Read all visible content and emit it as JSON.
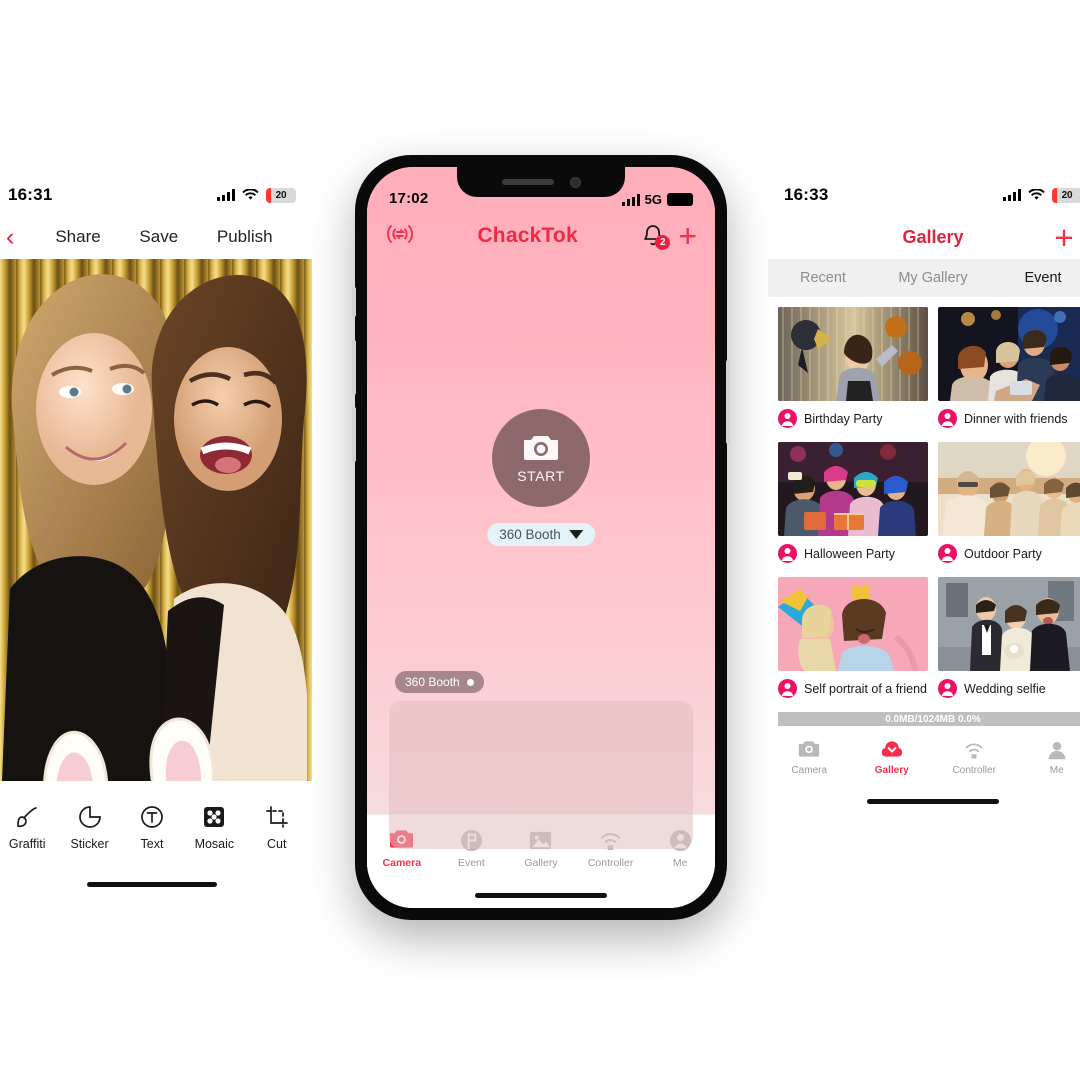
{
  "left_phone": {
    "status": {
      "time": "16:31",
      "battery": "20",
      "signal_icon": "cellular-bars-icon",
      "wifi_icon": "wifi-icon"
    },
    "nav": {
      "back_icon": "chevron-left-icon",
      "actions": [
        "Share",
        "Save",
        "Publish"
      ]
    },
    "photo": {
      "description": "Two women at a photo booth with gold foil curtain backdrop",
      "sticker": "bunny-ears-sticker"
    },
    "toolbar": [
      {
        "icon": "brush-icon",
        "label": "Graffiti"
      },
      {
        "icon": "sticker-icon",
        "label": "Sticker"
      },
      {
        "icon": "text-icon",
        "label": "Text"
      },
      {
        "icon": "mosaic-icon",
        "label": "Mosaic"
      },
      {
        "icon": "crop-icon",
        "label": "Cut"
      }
    ]
  },
  "center_phone": {
    "status": {
      "time": "17:02",
      "network": "5G",
      "signal_icon": "cellular-bars-icon",
      "battery_icon": "battery-full-icon"
    },
    "header": {
      "sync_icon": "broadcast-sync-icon",
      "title": "ChackTok",
      "bell_icon": "bell-icon",
      "bell_badge": "2",
      "add_icon": "plus-icon"
    },
    "capture": {
      "camera_icon": "camera-icon",
      "start_label": "START",
      "mode_label": "360 Booth",
      "mode_caret_icon": "caret-down-icon"
    },
    "queue": {
      "pill_label": "360 Booth",
      "pill_dot_icon": "status-dot-icon"
    },
    "tabs": [
      {
        "icon": "camera-icon",
        "label": "Camera",
        "active": true
      },
      {
        "icon": "event-flag-icon",
        "label": "Event",
        "active": false
      },
      {
        "icon": "gallery-image-icon",
        "label": "Gallery",
        "active": false
      },
      {
        "icon": "controller-wifi-icon",
        "label": "Controller",
        "active": false
      },
      {
        "icon": "person-icon",
        "label": "Me",
        "active": false
      }
    ],
    "colors": {
      "brand": "#ee2b42",
      "accent": "#f5304c",
      "bg_top": "#ffadba",
      "bg_bottom": "#f2dcdc"
    }
  },
  "right_phone": {
    "status": {
      "time": "16:33",
      "battery": "20",
      "signal_icon": "cellular-bars-icon",
      "wifi_icon": "wifi-icon"
    },
    "nav": {
      "title": "Gallery",
      "add_icon": "plus-icon"
    },
    "segments": [
      {
        "label": "Recent",
        "active": false
      },
      {
        "label": "My Gallery",
        "active": false
      },
      {
        "label": "Event",
        "active": true
      }
    ],
    "gallery": [
      [
        {
          "label": "Birthday Party",
          "avatar_icon": "person-avatar-icon",
          "thumb": "woman-with-balloons-gold-curtain"
        },
        {
          "label": "Dinner with friends",
          "avatar_icon": "person-avatar-icon",
          "thumb": "friends-selfie-at-bar"
        }
      ],
      [
        {
          "label": "Halloween Party",
          "avatar_icon": "person-avatar-icon",
          "thumb": "costume-party-group"
        },
        {
          "label": "Outdoor Party",
          "avatar_icon": "person-avatar-icon",
          "thumb": "outdoor-sunset-group"
        }
      ],
      [
        {
          "label": "Self portrait of a friend",
          "avatar_icon": "person-avatar-icon",
          "thumb": "two-women-pink-backdrop"
        },
        {
          "label": "Wedding selfie",
          "avatar_icon": "person-avatar-icon",
          "thumb": "wedding-couple-selfie"
        }
      ]
    ],
    "storage": {
      "text": "0.0MB/1024MB 0.0%",
      "percent": 0
    },
    "tabs": [
      {
        "icon": "camera-icon",
        "label": "Camera",
        "active": false
      },
      {
        "icon": "gallery-cloud-icon",
        "label": "Gallery",
        "active": true
      },
      {
        "icon": "controller-wifi-icon",
        "label": "Controller",
        "active": false
      },
      {
        "icon": "person-icon",
        "label": "Me",
        "active": false
      }
    ]
  }
}
